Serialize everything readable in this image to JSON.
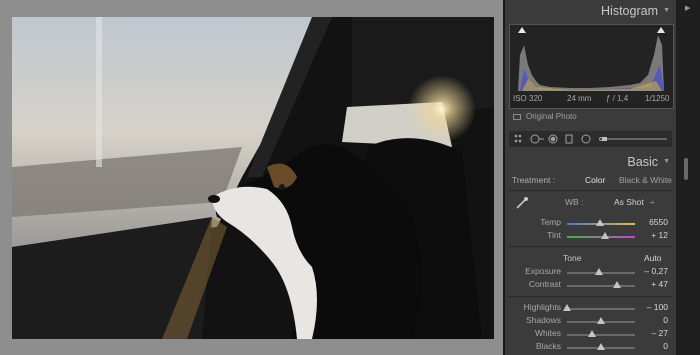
{
  "histogram": {
    "title": "Histogram",
    "iso": "ISO 320",
    "focal": "24 mm",
    "aperture": "ƒ / 1,4",
    "shutter": "1/1250",
    "original_photo": "Original Photo"
  },
  "basic": {
    "title": "Basic",
    "treatment_label": "Treatment :",
    "treatment_color": "Color",
    "treatment_bw": "Black & White",
    "wb_label": "WB :",
    "wb_value": "As Shot",
    "wb_dropdown_glyph": "÷",
    "tone_label": "Tone",
    "auto_label": "Auto",
    "sliders": [
      {
        "name": "Temp",
        "value": "6550",
        "level": 0.48
      },
      {
        "name": "Tint",
        "value": "+ 12",
        "level": 0.56
      },
      {
        "name": "Exposure",
        "value": "– 0,27",
        "level": 0.47
      },
      {
        "name": "Contrast",
        "value": "+ 47",
        "level": 0.74
      },
      {
        "name": "Highlights",
        "value": "– 100",
        "level": 0.0
      },
      {
        "name": "Shadows",
        "value": "0",
        "level": 0.5
      },
      {
        "name": "Whites",
        "value": "– 27",
        "level": 0.37
      },
      {
        "name": "Blacks",
        "value": "0",
        "level": 0.5
      }
    ]
  },
  "icons": {
    "panel_collapse": "triangle-down-icon",
    "eyedropper": "eyedropper-icon",
    "tools": [
      "grid-overlay-icon",
      "crop-icon",
      "spot-removal-icon",
      "red-eye-icon",
      "graduated-filter-icon",
      "radial-filter-icon",
      "adjustment-brush-icon"
    ]
  },
  "colors": {
    "panel_bg": "#3b3b3b",
    "canvas_bg": "#8e8e8e",
    "temp_track_left": "#4a78c8",
    "temp_track_right": "#d8c24a",
    "tint_track_left": "#4ab04a",
    "tint_track_right": "#c84ac8"
  }
}
